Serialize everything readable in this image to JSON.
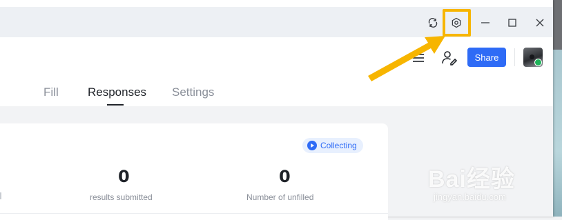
{
  "tabs": [
    {
      "label": "Fill"
    },
    {
      "label": "Responses"
    },
    {
      "label": "Settings"
    }
  ],
  "header": {
    "share_label": "Share"
  },
  "status": {
    "label": "Collecting"
  },
  "stats": [
    {
      "value": "0",
      "label": "results submitted"
    },
    {
      "value": "0",
      "label": "Number of unfilled"
    }
  ],
  "watermark": {
    "main": "Bai经验",
    "sub": "jingyan.baidu.com"
  },
  "colors": {
    "accent": "#2e6bf6",
    "highlight": "#f7b500"
  },
  "icons": [
    "sync-icon",
    "settings-gear-icon",
    "minimize-icon",
    "maximize-icon",
    "close-icon",
    "menu-icon",
    "user-edit-icon",
    "avatar",
    "play-circle-icon",
    "pointer-arrow"
  ]
}
